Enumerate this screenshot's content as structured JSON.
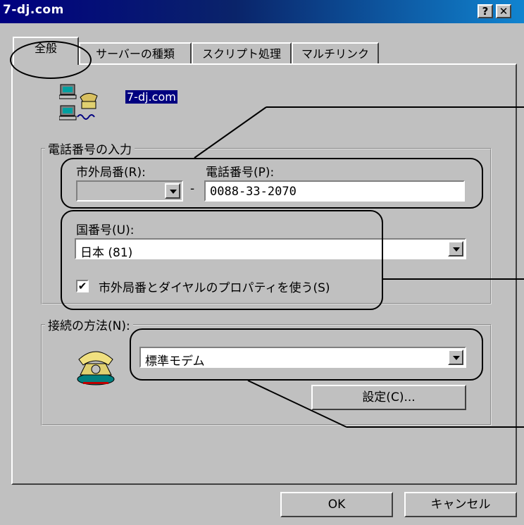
{
  "window": {
    "title": "7-dj.com",
    "help_btn": "?",
    "close_btn": "✕"
  },
  "tabs": [
    {
      "label": "全般"
    },
    {
      "label": "サーバーの種類"
    },
    {
      "label": "スクリプト処理"
    },
    {
      "label": "マルチリンク"
    }
  ],
  "connection": {
    "name": "7-dj.com"
  },
  "phone_group": {
    "title": "電話番号の入力",
    "area_code_label": "市外局番(R):",
    "area_code_value": "",
    "dash": "-",
    "phone_label": "電話番号(P):",
    "phone_value": "0088-33-2070",
    "country_label": "国番号(U):",
    "country_value": "日本 (81)",
    "use_dialing_properties_label": "市外局番とダイヤルのプロパティを使う(S)",
    "use_dialing_properties_checked": true,
    "check_mark": "✔"
  },
  "connect_group": {
    "title": "接続の方法(N):",
    "modem_value": "標準モデム",
    "configure_label": "設定(C)..."
  },
  "footer": {
    "ok_label": "OK",
    "cancel_label": "キャンセル"
  },
  "icons": {
    "connection_icon": "networked-computers-icon",
    "modem_icon": "telephone-icon"
  }
}
